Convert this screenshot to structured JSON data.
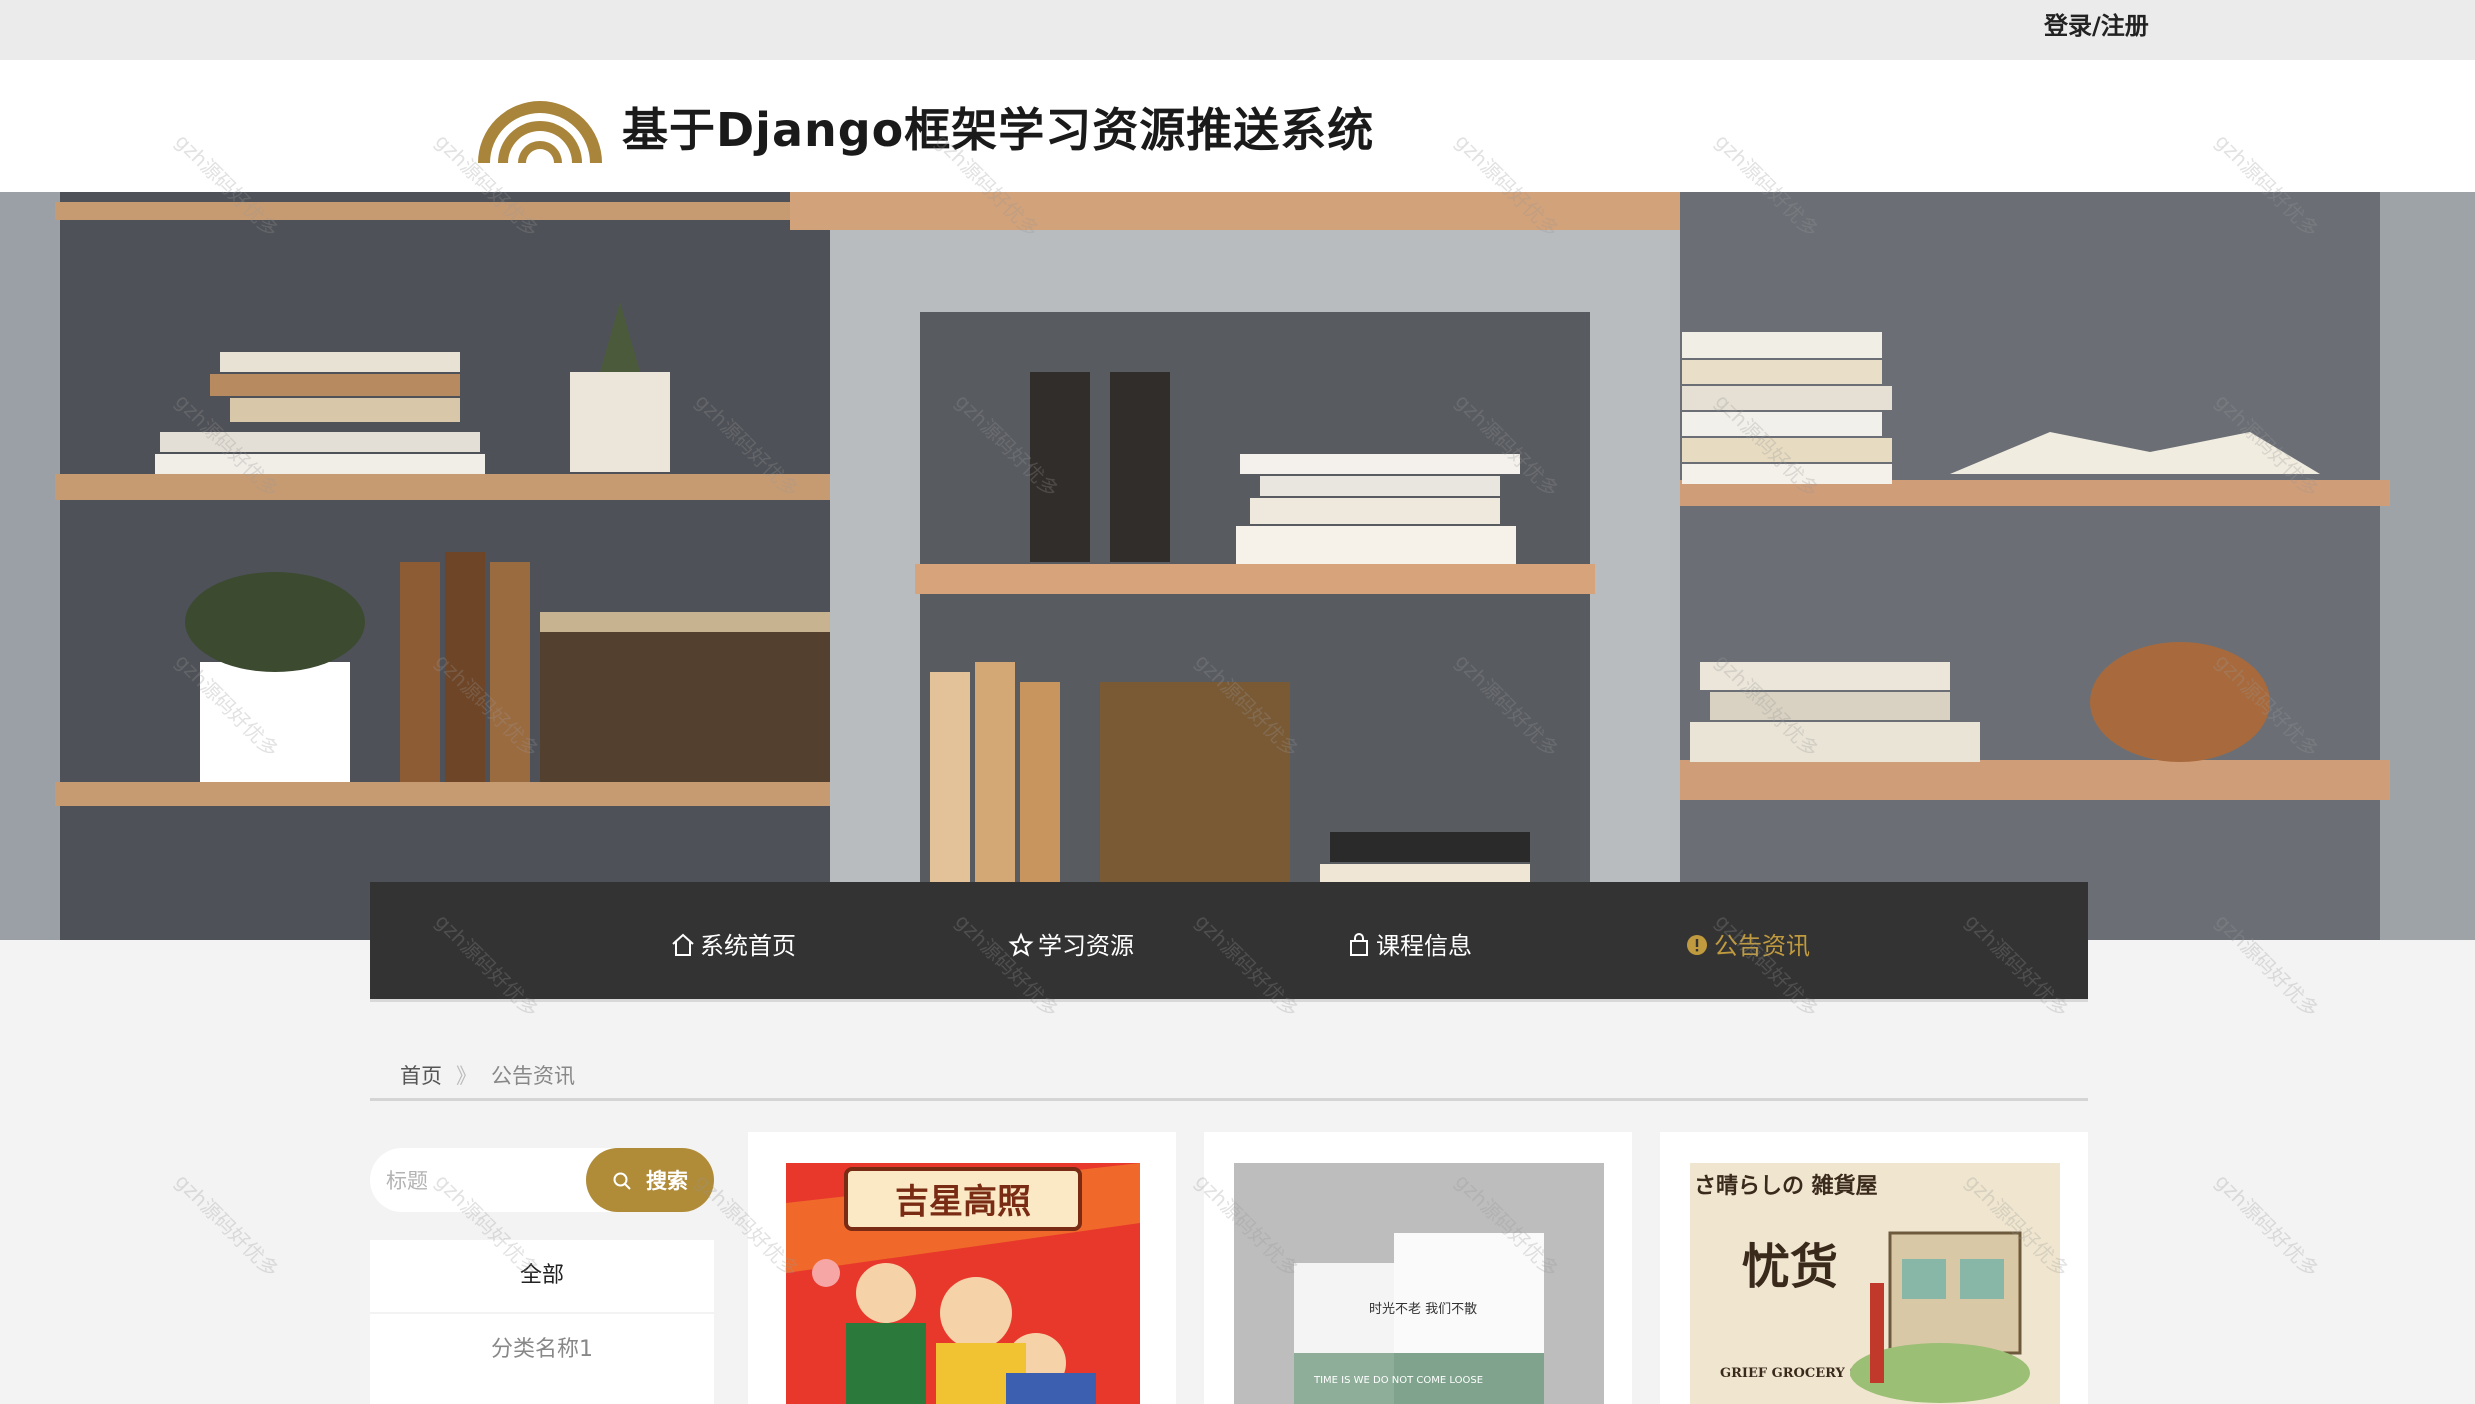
{
  "topbar": {
    "login_label": "登录/注册"
  },
  "header": {
    "title": "基于Django框架学习资源推送系统"
  },
  "nav": [
    {
      "label": "系统首页",
      "icon": "home-icon"
    },
    {
      "label": "学习资源",
      "icon": "star-icon"
    },
    {
      "label": "课程信息",
      "icon": "bag-icon"
    },
    {
      "label": "公告资讯",
      "icon": "info-icon",
      "active": true
    }
  ],
  "breadcrumb": {
    "home": "首页",
    "separator": "》",
    "current": "公告资讯"
  },
  "search": {
    "placeholder": "标题",
    "button_label": "搜索"
  },
  "categories": [
    {
      "label": "全部"
    },
    {
      "label": "分类名称1"
    }
  ],
  "cards": [
    {
      "image_text": "吉星高照"
    },
    {
      "image_text": "时光不老 我们不散",
      "image_subtext": "TIME IS WE DO NOT COME LOOSE"
    },
    {
      "image_text": "忧货",
      "image_text_jp": "さ晴らしの 雑貨屋",
      "image_subtext": "GRIEF GROCERY STORE"
    }
  ],
  "watermark": "gzh源码好优多",
  "colors": {
    "accent": "#b08b38",
    "nav_bg": "#333333",
    "active_nav": "#c09a3e"
  }
}
